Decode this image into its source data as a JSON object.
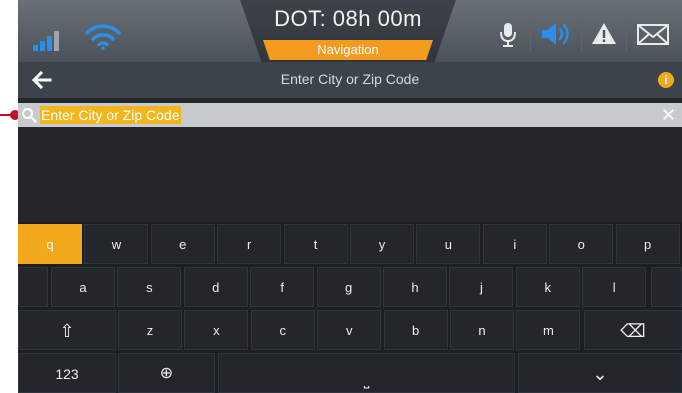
{
  "status": {
    "clock_text": "DOT: 08h 00m",
    "mode_badge": "Navigation",
    "accent": "#2b8fe8",
    "badge_color": "#f29b1d",
    "icons": [
      "signal-icon",
      "wifi-icon",
      "microphone-icon",
      "speaker-icon",
      "warning-icon",
      "mail-icon"
    ]
  },
  "header": {
    "title": "Enter City or Zip Code",
    "back_icon": "back-arrow-icon",
    "info_label": "i"
  },
  "search": {
    "value": "Enter City or Zip Code",
    "highlight_color": "#f2b51d",
    "clear_label": "✕"
  },
  "keyboard": {
    "row1": [
      "q",
      "w",
      "e",
      "r",
      "t",
      "y",
      "u",
      "i",
      "o",
      "p"
    ],
    "row2": [
      "a",
      "s",
      "d",
      "f",
      "g",
      "h",
      "j",
      "k",
      "l"
    ],
    "row3": [
      "z",
      "x",
      "c",
      "v",
      "b",
      "n",
      "m"
    ],
    "shift_symbol": "⇧",
    "backspace_symbol": "⌫",
    "numbers_label": "123",
    "globe_symbol": "⊕",
    "space_symbol": "⎵",
    "hide_symbol": "⌄",
    "active_key": "q"
  }
}
